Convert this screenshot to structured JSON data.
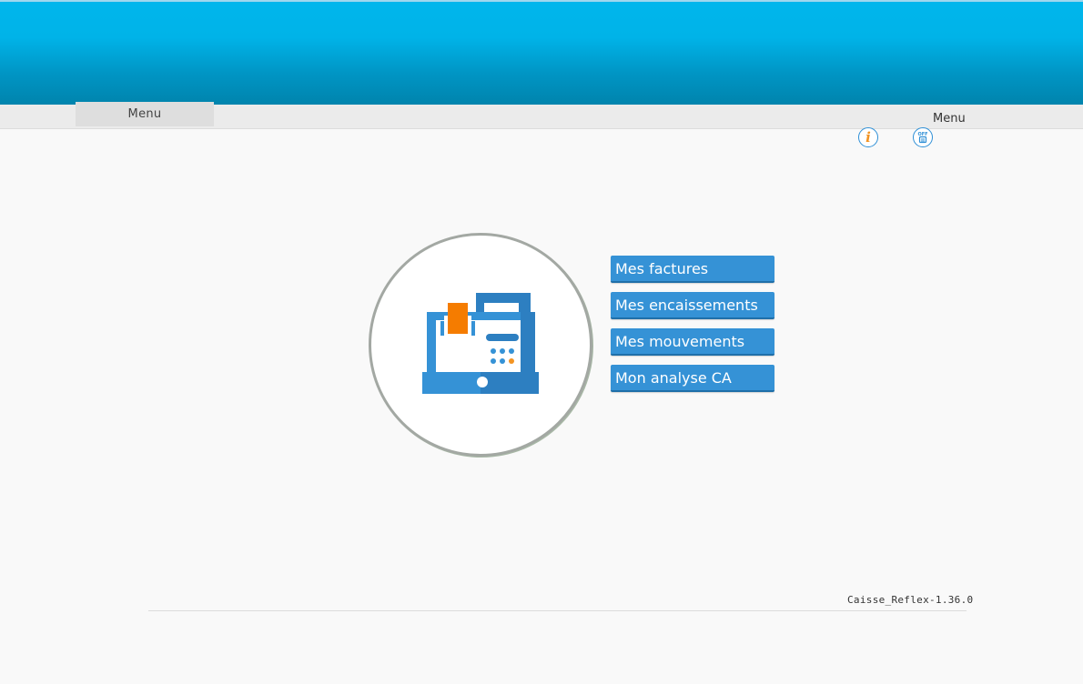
{
  "header": {
    "menu_tab_label": "Menu",
    "menu_right_label": "Menu"
  },
  "icons": {
    "info": "info-icon",
    "power_off": "power-off-icon",
    "info_glyph": "i",
    "off_glyph": "OFF"
  },
  "main": {
    "illustration": "cash-register-icon",
    "buttons": [
      {
        "label": "Mes factures"
      },
      {
        "label": "Mes encaissements"
      },
      {
        "label": "Mes mouvements"
      },
      {
        "label": "Mon analyse CA"
      }
    ]
  },
  "footer": {
    "version": "Caisse_Reflex-1.36.0"
  },
  "colors": {
    "header_top": "#00b6ec",
    "header_bottom": "#0084ad",
    "button_blue": "#3592d6",
    "accent_orange": "#f39422"
  }
}
